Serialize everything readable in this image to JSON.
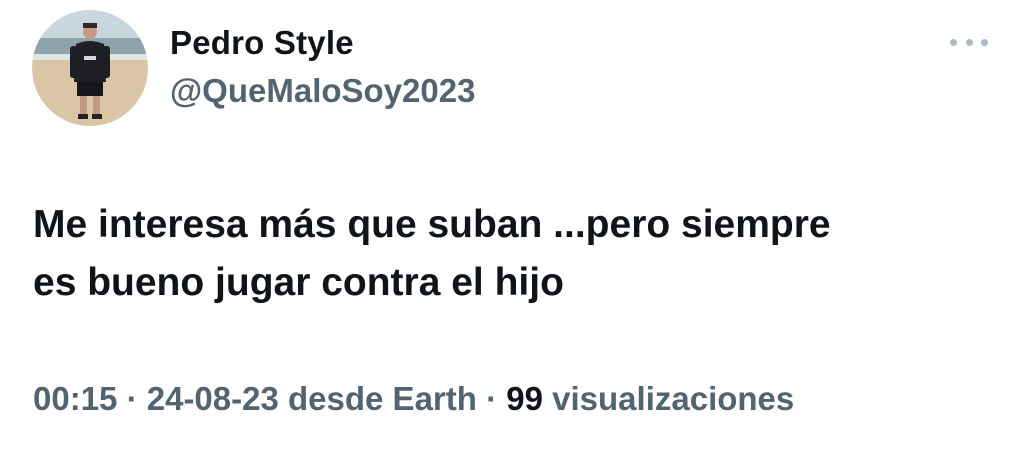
{
  "author": {
    "name": "Pedro Style",
    "handle": "@QueMaloSoy2023"
  },
  "avatar_icon": "profile-photo",
  "more_icon": "more-horizontal-icon",
  "tweet": {
    "line1": "Me interesa más que suban ...pero siempre",
    "line2": "es bueno jugar contra el hijo"
  },
  "meta": {
    "time": "00:15",
    "separator1": " · ",
    "date": "24-08-23",
    "source": " desde Earth",
    "separator2": " · ",
    "views_count": "99",
    "views_label": " visualizaciones"
  },
  "colors": {
    "text_primary": "#0f1419",
    "text_secondary": "#536471",
    "dots": "#aab8c2"
  }
}
